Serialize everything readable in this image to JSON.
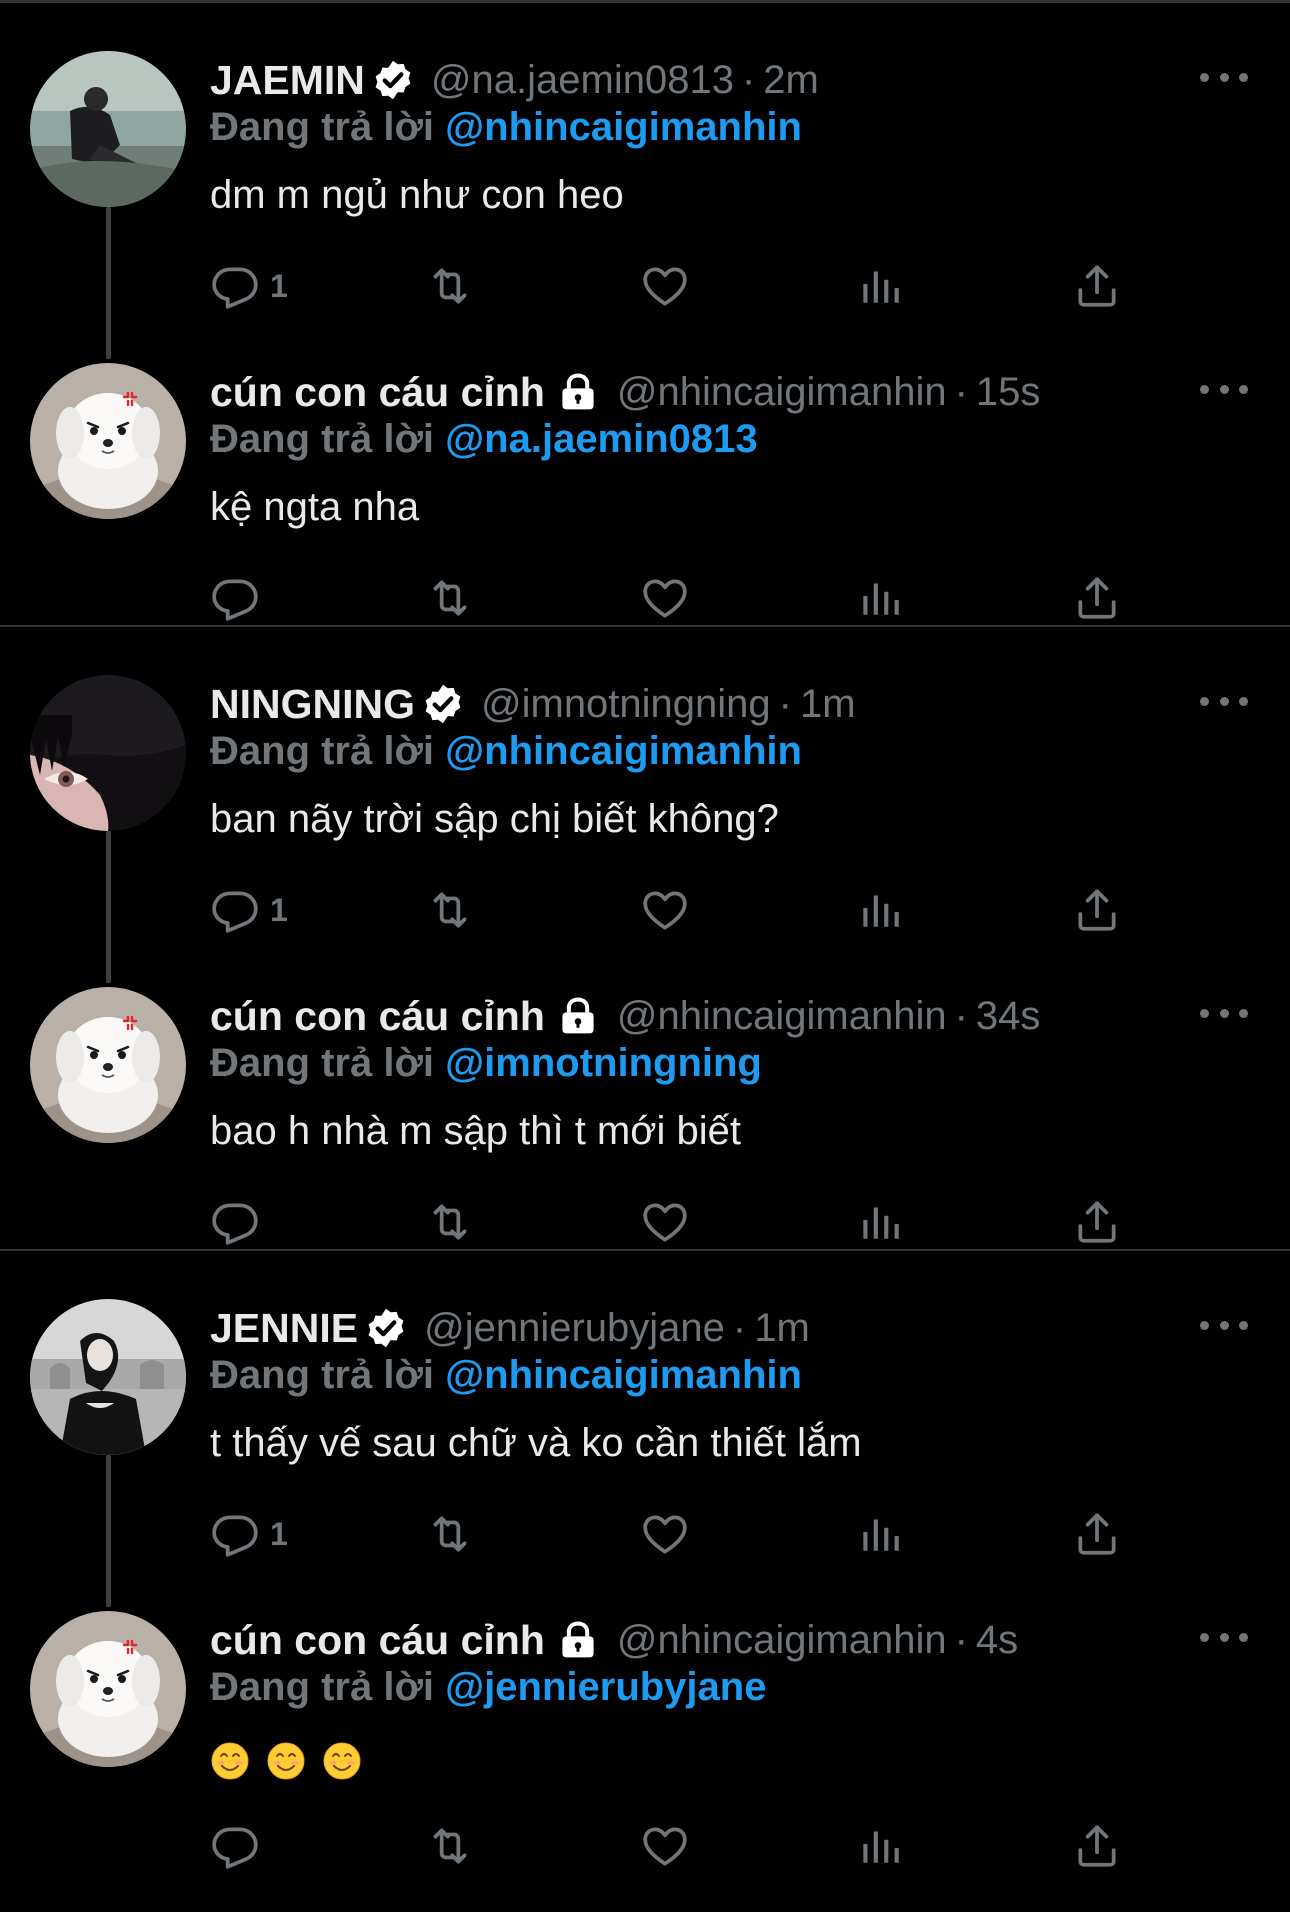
{
  "reply_prefix": "Đang trả lời",
  "colors": {
    "background": "#000000",
    "text": "#e7e9ea",
    "muted": "#71767b",
    "accent": "#1d9bf0",
    "divider": "#2f3336"
  },
  "threads": [
    {
      "parent": {
        "name": "JAEMIN",
        "verified": true,
        "handle": "@na.jaemin0813",
        "time": "2m",
        "reply_to": "@nhincaigimanhin",
        "text": "dm m ngủ như con heo",
        "reply_count": "1",
        "avatar": "person-sitting-photo"
      },
      "reply": {
        "name": "cún con cáu cỉnh",
        "protected": true,
        "handle": "@nhincaigimanhin",
        "time": "15s",
        "reply_to": "@na.jaemin0813",
        "text": "kệ ngta nha",
        "reply_count": "",
        "avatar": "white-puppy-photo"
      }
    },
    {
      "parent": {
        "name": "NINGNING",
        "verified": true,
        "handle": "@imnotningning",
        "time": "1m",
        "reply_to": "@nhincaigimanhin",
        "text": "ban nãy trời sập chị biết không?",
        "reply_count": "1",
        "avatar": "woman-eye-closeup-photo"
      },
      "reply": {
        "name": "cún con cáu cỉnh",
        "protected": true,
        "handle": "@nhincaigimanhin",
        "time": "34s",
        "reply_to": "@imnotningning",
        "text": "bao h nhà m sập thì t mới biết",
        "reply_count": "",
        "avatar": "white-puppy-photo"
      }
    },
    {
      "parent": {
        "name": "JENNIE",
        "verified": true,
        "handle": "@jennierubyjane",
        "time": "1m",
        "reply_to": "@nhincaigimanhin",
        "text": "t thấy vế sau chữ và ko cần thiết lắm",
        "reply_count": "1",
        "avatar": "woman-monochrome-photo"
      },
      "reply": {
        "name": "cún con cáu cỉnh",
        "protected": true,
        "handle": "@nhincaigimanhin",
        "time": "4s",
        "reply_to": "@jennierubyjane",
        "text": "",
        "emojis": [
          "smiling-face-emoji",
          "smiling-face-emoji",
          "smiling-face-emoji"
        ],
        "reply_count": "",
        "avatar": "white-puppy-photo"
      }
    }
  ]
}
